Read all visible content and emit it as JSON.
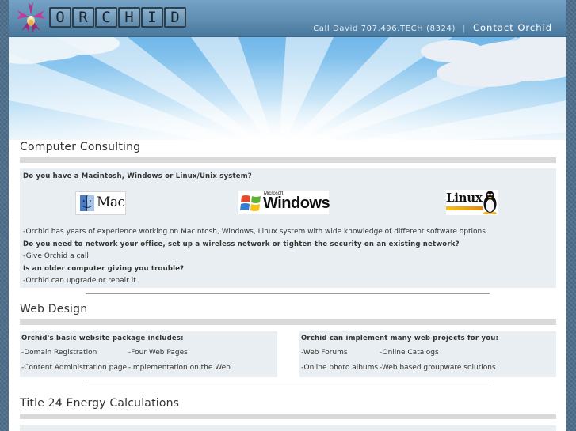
{
  "header": {
    "logo_letters": [
      "O",
      "R",
      "C",
      "H",
      "I",
      "D"
    ],
    "call_text": "Call David 707.496.TECH (8324)",
    "separator": "|",
    "contact_link": "Contact Orchid"
  },
  "consulting": {
    "title": "Computer Consulting",
    "q1": "Do you have a Macintosh, Windows or Linux/Unix system?",
    "logos": {
      "mac": "Mac",
      "windows_small": "Microsoft",
      "windows": "Windows",
      "linux": "Linux"
    },
    "a1": "-Orchid has years of experience working on Macintosh, Windows, Linux system with wide knowledge of different software options",
    "q2": "Do you need to network your office, set up a wireless network or tighten the security on an existing network?",
    "a2": "-Give Orchid a call",
    "q3": "Is an older computer giving you trouble?",
    "a3": "-Orchid can upgrade or repair it"
  },
  "webdesign": {
    "title": "Web Design",
    "left": {
      "heading": "Orchid's basic website package includes:",
      "items": [
        "-Domain Registration",
        "-Four Web Pages",
        "-Content Administration page",
        "-Implementation on the Web"
      ]
    },
    "right": {
      "heading": "Orchid can implement many web projects for you:",
      "items": [
        "-Web Forums",
        "-Online Catalogs",
        "-Online photo albums",
        "-Web based groupware solutions"
      ]
    }
  },
  "title24": {
    "title": "Title 24 Energy Calculations"
  },
  "colors": {
    "header_top": "#74a1c4",
    "header_bottom": "#4a789d",
    "sky_top": "#6fb7ea",
    "panel_bg": "#e8eef1",
    "divider_bar": "#d9d9d9"
  }
}
